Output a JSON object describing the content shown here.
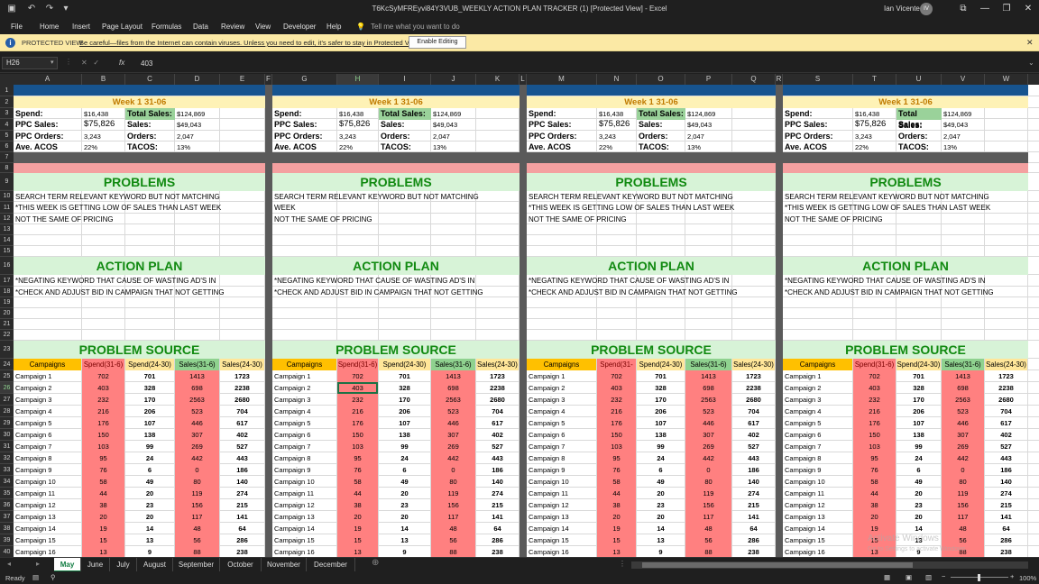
{
  "window": {
    "title": "T6KcSyMFREyvi84Y3VUB_WEEKLY ACTION PLAN TRACKER (1)  [Protected View]  -  Excel",
    "user": "Ian Vicente",
    "avatar_initials": "IV"
  },
  "menu": [
    "File",
    "Home",
    "Insert",
    "Page Layout",
    "Formulas",
    "Data",
    "Review",
    "View",
    "Developer",
    "Help"
  ],
  "tell_me": "Tell me what you want to do",
  "protected_view": {
    "label": "PROTECTED VIEW",
    "message": "Be careful—files from the Internet can contain viruses. Unless you need to edit, it's safer to stay in Protected View.",
    "button": "Enable Editing"
  },
  "formula_bar": {
    "name_box": "H26",
    "fx": "fx",
    "value": "403"
  },
  "columns": [
    "A",
    "B",
    "C",
    "D",
    "E",
    "F",
    "G",
    "H",
    "I",
    "J",
    "K",
    "L",
    "M",
    "N",
    "O",
    "P",
    "Q",
    "R",
    "S",
    "T",
    "U",
    "V",
    "W"
  ],
  "rows": [
    "1",
    "2",
    "3",
    "4",
    "5",
    "6",
    "7",
    "8",
    "9",
    "10",
    "11",
    "12",
    "13",
    "14",
    "15",
    "16",
    "17",
    "18",
    "19",
    "20",
    "21",
    "22",
    "23",
    "24",
    "25",
    "26",
    "27",
    "28",
    "29",
    "30",
    "31",
    "32",
    "33",
    "34",
    "35",
    "36",
    "37",
    "38",
    "39",
    "40"
  ],
  "week_title": "Week 1 31-06",
  "summary": {
    "spend_label": "Spend:",
    "spend": "$16,438",
    "total_sales_label": "Total Sales:",
    "total_sales": "$124,869",
    "ppc_sales_label": "PPC Sales:",
    "ppc_sales": "$75,826",
    "sales_label": "Sales:",
    "sales": "$49,043",
    "ppc_orders_label": "PPC Orders:",
    "ppc_orders": "3,243",
    "orders_label": "Orders:",
    "orders": "2,047",
    "acos_label": "Ave. ACOS",
    "acos": "22%",
    "tacos_label": "TACOS:",
    "tacos": "13%"
  },
  "problems_title": "PROBLEMS",
  "problems": [
    "SEARCH TERM RELEVANT KEYWORD BUT NOT MATCHING",
    "*THIS WEEK IS GETTING LOW OF SALES THAN LAST WEEK",
    "NOT THE SAME OF PRICING"
  ],
  "problems_alt": [
    "SEARCH TERM RELEVANT KEYWORD BUT NOT MATCHING",
    "WEEK",
    "NOT THE SAME OF PRICING"
  ],
  "action_title": "ACTION PLAN",
  "actions": [
    "*NEGATING KEYWORD THAT CAUSE OF WASTING AD'S IN",
    "*CHECK AND ADJUST BID IN CAMPAIGN THAT NOT GETTING"
  ],
  "source_title": "PROBLEM SOURCE",
  "table_headers": [
    "Campaigns",
    "Spend(31-6)",
    "Spend(24-30)",
    "Sales(31-6)",
    "Sales(24-30)"
  ],
  "campaigns": [
    [
      "Campaign 1",
      "702",
      "701",
      "1413",
      "1723"
    ],
    [
      "Campaign 2",
      "403",
      "328",
      "698",
      "2238"
    ],
    [
      "Campaign 3",
      "232",
      "170",
      "2563",
      "2680"
    ],
    [
      "Campaign 4",
      "216",
      "206",
      "523",
      "704"
    ],
    [
      "Campaign 5",
      "176",
      "107",
      "446",
      "617"
    ],
    [
      "Campaign 6",
      "150",
      "138",
      "307",
      "402"
    ],
    [
      "Campaign 7",
      "103",
      "99",
      "269",
      "527"
    ],
    [
      "Campaign 8",
      "95",
      "24",
      "442",
      "443"
    ],
    [
      "Campaign 9",
      "76",
      "6",
      "0",
      "186"
    ],
    [
      "Campaign 10",
      "58",
      "49",
      "80",
      "140"
    ],
    [
      "Campaign 11",
      "44",
      "20",
      "119",
      "274"
    ],
    [
      "Campaign 12",
      "38",
      "23",
      "156",
      "215"
    ],
    [
      "Campaign 13",
      "20",
      "20",
      "117",
      "141"
    ],
    [
      "Campaign 14",
      "19",
      "14",
      "48",
      "64"
    ],
    [
      "Campaign 15",
      "15",
      "13",
      "56",
      "286"
    ],
    [
      "Campaign 16",
      "13",
      "9",
      "88",
      "238"
    ]
  ],
  "sheets": [
    "May",
    "June",
    "July",
    "August",
    "September",
    "October",
    "November",
    "December"
  ],
  "active_sheet": "May",
  "status": {
    "ready": "Ready",
    "zoom": "100%"
  },
  "watermark": {
    "line1": "Activate Windows",
    "line2": "Go to Settings to activate Windows."
  }
}
